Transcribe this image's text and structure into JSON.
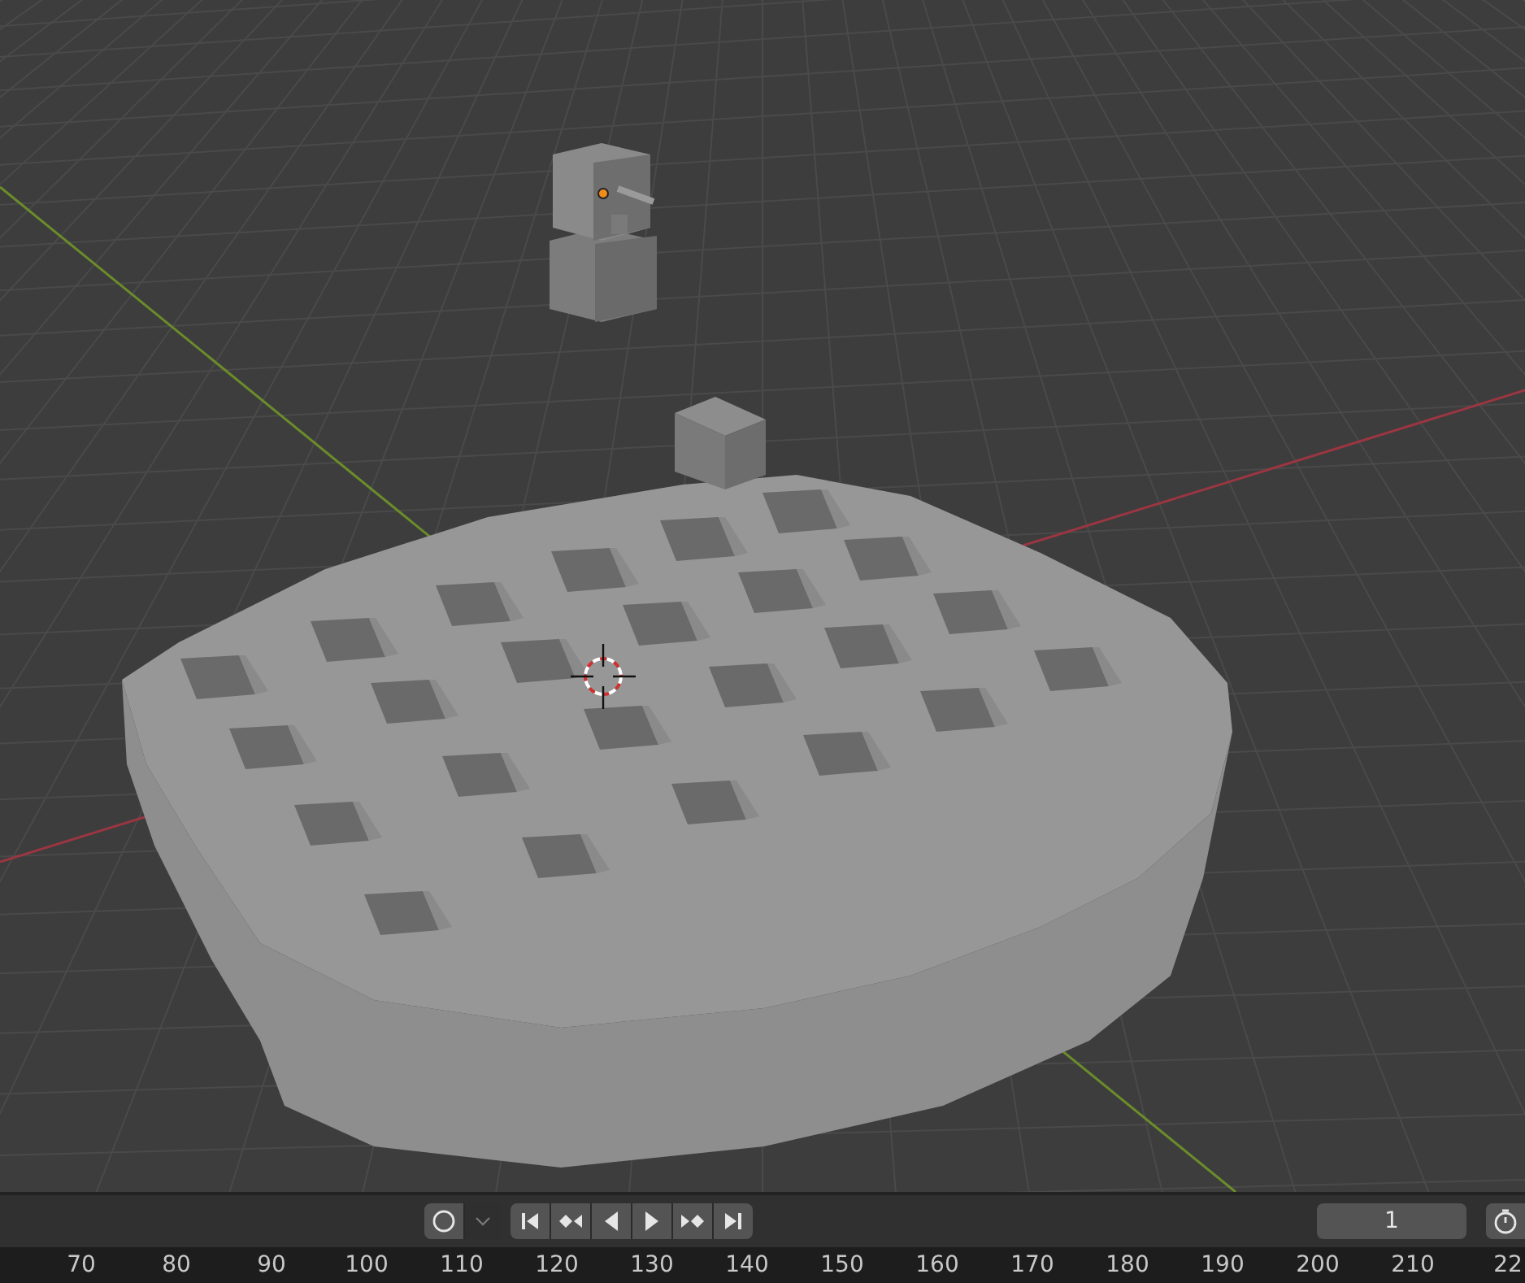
{
  "timeline": {
    "auto_keying": {
      "on": false
    },
    "current_frame": {
      "value": "1"
    },
    "ruler": {
      "labels": [
        "70",
        "80",
        "90",
        "100",
        "110",
        "120",
        "130",
        "140",
        "150",
        "160",
        "170",
        "180",
        "190",
        "200",
        "210",
        "22"
      ]
    }
  }
}
